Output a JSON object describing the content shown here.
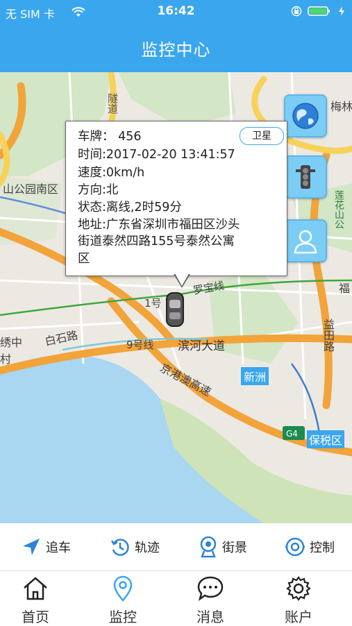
{
  "status_bar": {
    "carrier": "无 SIM 卡",
    "time": "16:42"
  },
  "nav": {
    "title": "监控中心"
  },
  "popup": {
    "plate": "车牌：  456",
    "satellite": "卫星",
    "time": "时间:2017-02-20 13:41:57",
    "speed": "速度:0km/h",
    "direction": "方向:北",
    "state": "状态:离线,2时59分",
    "address_1": "地址:广东省深圳市福田区沙头",
    "address_2": "街道泰然四路155号泰然公寓",
    "address_3": "区"
  },
  "map_labels": {
    "road1": "隧道",
    "road2": "山公园南区",
    "road3": "白石路",
    "road4": "滨河大道",
    "road5": "京港澳高速",
    "road6": "新洲",
    "road7": "保税区",
    "road8": "益田路",
    "road9": "罗宝线",
    "road10": "9号线",
    "road11": "1号",
    "road12": "G4",
    "road13": "梅林",
    "road14": "莲花山公",
    "road15": "福",
    "road16": "绣中村"
  },
  "toolbar": {
    "chase": "追车",
    "track": "轨迹",
    "street": "街景",
    "control": "控制"
  },
  "tabs": {
    "home": "首页",
    "monitor": "监控",
    "message": "消息",
    "account": "账户"
  },
  "colors": {
    "brand": "#3aa6ee",
    "road_main": "#f2a33a",
    "road_yellow": "#f7d25a",
    "water": "#a7d5f0",
    "green": "#cfe4c2"
  }
}
